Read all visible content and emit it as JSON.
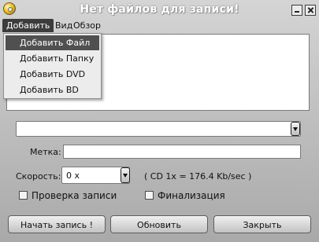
{
  "window": {
    "title": "Нет файлов для записи!"
  },
  "menu": {
    "items": [
      "Добавить",
      "Вид",
      "Обзор"
    ],
    "dropdown": [
      "Добавить Файл",
      "Добавить Папку",
      "Добавить DVD",
      "Добавить BD"
    ]
  },
  "form": {
    "drive_value": "",
    "label_caption": "Метка:",
    "label_value": "",
    "speed_caption": "Скорость:",
    "speed_value": "0 x",
    "speed_info": "( CD 1x = 176.4 Kb/sec )",
    "verify_label": "Проверка записи",
    "verify_checked": false,
    "finalize_label": "Финализация",
    "finalize_checked": false
  },
  "buttons": {
    "start": "Начать запись !",
    "refresh": "Обновить",
    "close": "Закрыть"
  },
  "colors": {
    "menu_active": "#3c3c3c",
    "menu_item_highlight": "#505050",
    "panel_bg": "#ffffff"
  },
  "icons": [
    "app-disc-icon",
    "minimize-icon",
    "close-icon",
    "chevron-down-icon"
  ]
}
